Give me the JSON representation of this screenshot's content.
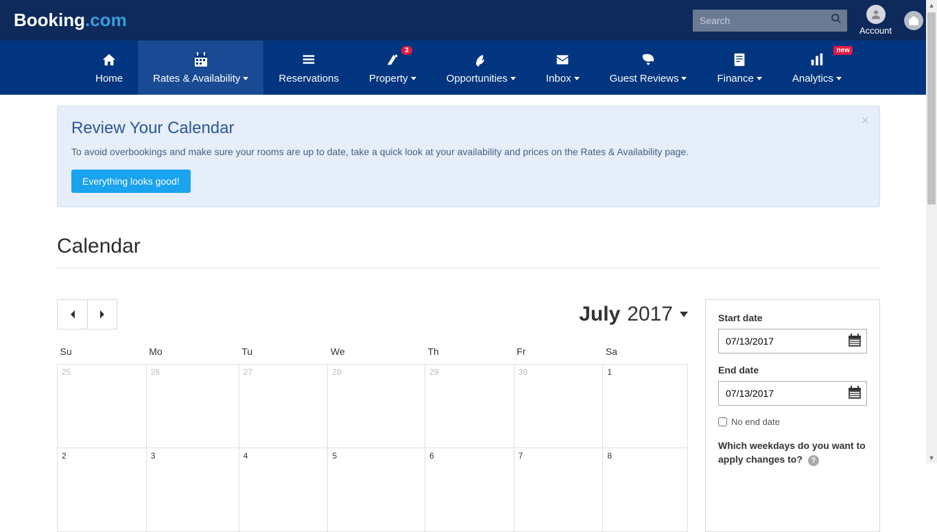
{
  "header": {
    "logo_main": "Booking",
    "logo_suffix": ".com",
    "search_placeholder": "Search",
    "account_label": "Account"
  },
  "nav": {
    "items": [
      {
        "label": "Home",
        "has_caret": false
      },
      {
        "label": "Rates & Availability",
        "has_caret": true,
        "active": true
      },
      {
        "label": "Reservations",
        "has_caret": false
      },
      {
        "label": "Property",
        "has_caret": true,
        "badge": "3"
      },
      {
        "label": "Opportunities",
        "has_caret": true
      },
      {
        "label": "Inbox",
        "has_caret": true
      },
      {
        "label": "Guest Reviews",
        "has_caret": true
      },
      {
        "label": "Finance",
        "has_caret": true
      },
      {
        "label": "Analytics",
        "has_caret": true,
        "new_badge": "new"
      }
    ]
  },
  "alert": {
    "title": "Review Your Calendar",
    "body": "To avoid overbookings and make sure your rooms are up to date, take a quick look at your availability and prices on the Rates & Availability page.",
    "button": "Everything looks good!"
  },
  "page_title": "Calendar",
  "calendar": {
    "month": "July",
    "year": "2017",
    "weekdays": [
      "Su",
      "Mo",
      "Tu",
      "We",
      "Th",
      "Fr",
      "Sa"
    ],
    "rows": [
      [
        {
          "d": "25",
          "muted": true
        },
        {
          "d": "26",
          "muted": true
        },
        {
          "d": "27",
          "muted": true
        },
        {
          "d": "28",
          "muted": true
        },
        {
          "d": "29",
          "muted": true
        },
        {
          "d": "30",
          "muted": true
        },
        {
          "d": "1"
        }
      ],
      [
        {
          "d": "2"
        },
        {
          "d": "3"
        },
        {
          "d": "4"
        },
        {
          "d": "5"
        },
        {
          "d": "6"
        },
        {
          "d": "7"
        },
        {
          "d": "8"
        }
      ]
    ]
  },
  "sidebar": {
    "start_label": "Start date",
    "start_value": "07/13/2017",
    "end_label": "End date",
    "end_value": "07/13/2017",
    "no_end_label": "No end date",
    "question": "Which weekdays do you want to apply changes to?"
  }
}
